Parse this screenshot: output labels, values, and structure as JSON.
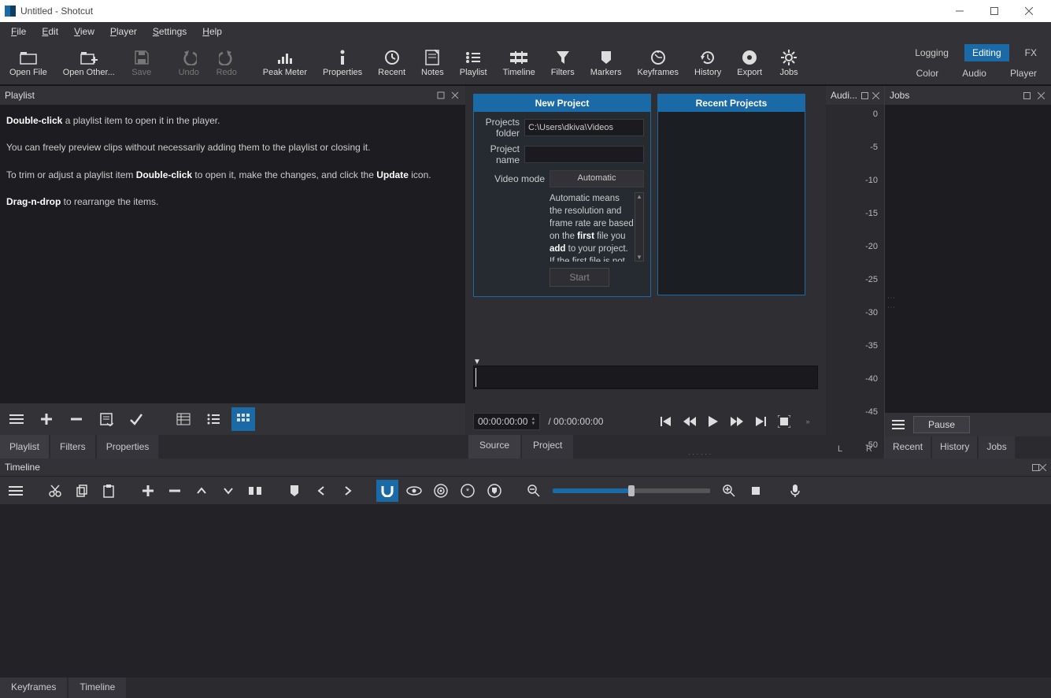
{
  "window": {
    "title": "Untitled - Shotcut"
  },
  "menubar": [
    "File",
    "Edit",
    "View",
    "Player",
    "Settings",
    "Help"
  ],
  "toolbar": [
    {
      "id": "open-file",
      "label": "Open File",
      "icon": "folder"
    },
    {
      "id": "open-other",
      "label": "Open Other...",
      "icon": "folder-plus"
    },
    {
      "id": "save",
      "label": "Save",
      "icon": "save",
      "disabled": true
    },
    {
      "id": "undo",
      "label": "Undo",
      "icon": "undo",
      "disabled": true
    },
    {
      "id": "redo",
      "label": "Redo",
      "icon": "redo",
      "disabled": true
    },
    {
      "id": "peak-meter",
      "label": "Peak Meter",
      "icon": "meter"
    },
    {
      "id": "properties",
      "label": "Properties",
      "icon": "info"
    },
    {
      "id": "recent",
      "label": "Recent",
      "icon": "clock"
    },
    {
      "id": "notes",
      "label": "Notes",
      "icon": "note"
    },
    {
      "id": "playlist",
      "label": "Playlist",
      "icon": "list"
    },
    {
      "id": "timeline",
      "label": "Timeline",
      "icon": "timeline"
    },
    {
      "id": "filters",
      "label": "Filters",
      "icon": "funnel"
    },
    {
      "id": "markers",
      "label": "Markers",
      "icon": "marker"
    },
    {
      "id": "keyframes",
      "label": "Keyframes",
      "icon": "keyframes"
    },
    {
      "id": "history",
      "label": "History",
      "icon": "history"
    },
    {
      "id": "export",
      "label": "Export",
      "icon": "disc"
    },
    {
      "id": "jobs",
      "label": "Jobs",
      "icon": "gear"
    }
  ],
  "right_tabs": {
    "row1": [
      "Logging",
      "Editing",
      "FX"
    ],
    "active1": "Editing",
    "row2": [
      "Color",
      "Audio",
      "Player"
    ]
  },
  "playlist": {
    "title": "Playlist",
    "hints": {
      "l1a": "Double-click",
      "l1b": " a playlist item to open it in the player.",
      "l2": "You can freely preview clips without necessarily adding them to the playlist or closing it.",
      "l3a": "To trim or adjust a playlist item ",
      "l3b": "Double-click",
      "l3c": " to open it, make the changes, and click the ",
      "l3d": "Update",
      "l3e": " icon.",
      "l4a": "Drag-n-drop",
      "l4b": " to rearrange the items."
    },
    "tabs": [
      "Playlist",
      "Filters",
      "Properties"
    ]
  },
  "new_project": {
    "title": "New Project",
    "folder_label": "Projects folder",
    "folder_value": "C:\\Users\\dkiva\\Videos",
    "name_label": "Project name",
    "name_value": "",
    "mode_label": "Video mode",
    "mode_value": "Automatic",
    "desc_a": "Automatic means the resolution and frame rate are based on the ",
    "desc_b": "first",
    "desc_c": " file you ",
    "desc_d": "add",
    "desc_e": " to your project. If the first file is not",
    "start": "Start"
  },
  "recent_projects": {
    "title": "Recent Projects"
  },
  "transport": {
    "tc": "00:00:00:00",
    "dur": "/ 00:00:00:00"
  },
  "src_tabs": [
    "Source",
    "Project"
  ],
  "audio_panel": {
    "title": "Audi...",
    "ticks": [
      0,
      -5,
      -10,
      -15,
      -20,
      -25,
      -30,
      -35,
      -40,
      -45,
      -50
    ],
    "L": "L",
    "R": "R"
  },
  "jobs_panel": {
    "title": "Jobs",
    "pause": "Pause",
    "tabs": [
      "Recent",
      "History",
      "Jobs"
    ]
  },
  "timeline": {
    "title": "Timeline",
    "tabs": [
      "Keyframes",
      "Timeline"
    ]
  }
}
